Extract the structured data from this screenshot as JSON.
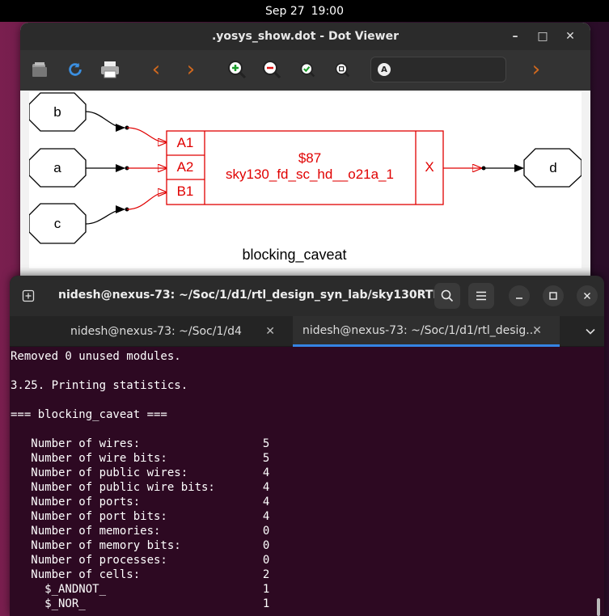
{
  "topbar": {
    "date": "Sep 27",
    "time": "19:00"
  },
  "dot_viewer": {
    "title": ".yosys_show.dot - Dot Viewer",
    "controls": {
      "minimize": "–",
      "maximize": "□",
      "close": "✕"
    },
    "toolbar_icons": [
      "open-icon",
      "refresh-icon",
      "print-icon",
      "back-icon",
      "forward-icon",
      "zoom-in-icon",
      "zoom-out-icon",
      "zoom-fit-icon",
      "zoom-100-icon"
    ],
    "search_placeholder": "",
    "graph": {
      "inputs": [
        "b",
        "a",
        "c"
      ],
      "output": "d",
      "cell_id": "$87",
      "cell_type": "sky130_fd_sc_hd__o21a_1",
      "ports_in": [
        "A1",
        "A2",
        "B1"
      ],
      "port_out": "X",
      "label": "blocking_caveat"
    },
    "colors": {
      "cell": "#e00000",
      "wire": "#000000"
    }
  },
  "terminal": {
    "title": "nidesh@nexus-73: ~/Soc/1/d1/rtl_design_syn_lab/sky130RTL...",
    "tabs": [
      {
        "label": "nidesh@nexus-73: ~/Soc/1/d4"
      },
      {
        "label": "nidesh@nexus-73: ~/Soc/1/d1/rtl_desig..."
      }
    ],
    "lines": [
      "Removed 0 unused modules.",
      "",
      "3.25. Printing statistics.",
      "",
      "=== blocking_caveat ===",
      "",
      "   Number of wires:                  5",
      "   Number of wire bits:              5",
      "   Number of public wires:           4",
      "   Number of public wire bits:       4",
      "   Number of ports:                  4",
      "   Number of port bits:              4",
      "   Number of memories:               0",
      "   Number of memory bits:            0",
      "   Number of processes:              0",
      "   Number of cells:                  2",
      "     $_ANDNOT_                       1",
      "     $_NOR_                          1"
    ]
  }
}
